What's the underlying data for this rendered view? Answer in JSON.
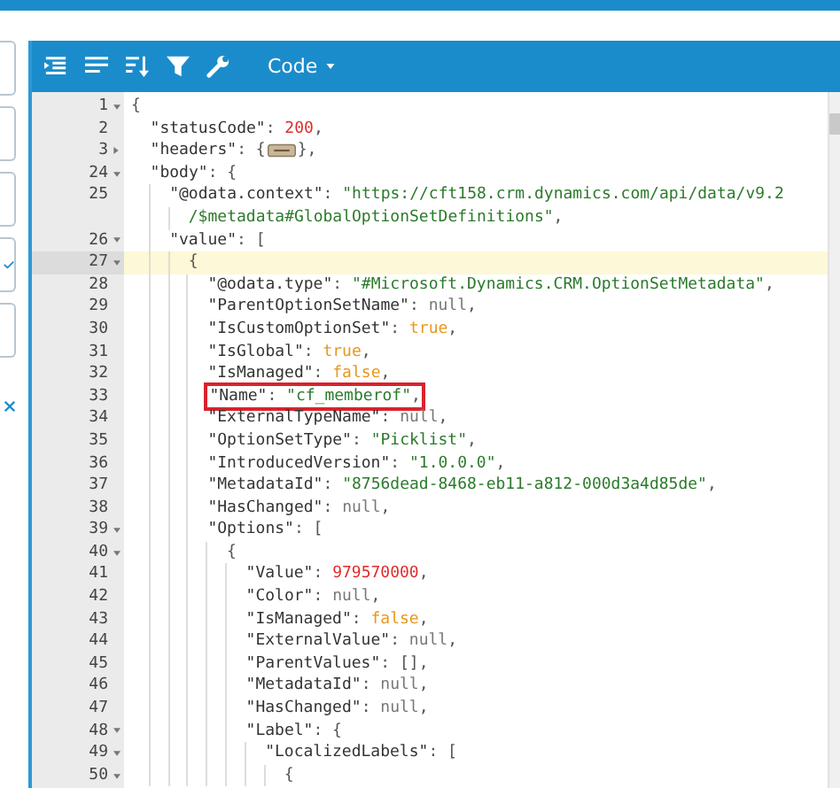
{
  "sidebar": {
    "tabs": [
      {
        "kind": "plain"
      },
      {
        "kind": "plain"
      },
      {
        "kind": "plain"
      },
      {
        "kind": "check"
      },
      {
        "kind": "plain"
      }
    ]
  },
  "toolbar": {
    "mode": "Code"
  },
  "editor": {
    "lines": [
      {
        "num": "1",
        "kind": "block",
        "expanded": true,
        "active": false,
        "boxed": false,
        "tokens": [
          {
            "kind": "punct",
            "text": "{"
          }
        ],
        "children": [
          {
            "num": "2",
            "kind": "line",
            "active": false,
            "boxed": false,
            "tokens": [
              {
                "kind": "key",
                "text": "\"statusCode\""
              },
              {
                "kind": "punct",
                "text": ": "
              },
              {
                "kind": "number",
                "text": "200"
              },
              {
                "kind": "punct",
                "text": ","
              }
            ]
          },
          {
            "num": "3",
            "kind": "block",
            "expanded": false,
            "active": false,
            "boxed": false,
            "tokens": [
              {
                "kind": "key",
                "text": "\"headers\""
              },
              {
                "kind": "punct",
                "text": ": {"
              },
              {
                "kind": "placeholder"
              },
              {
                "kind": "punct",
                "text": "},"
              }
            ]
          },
          {
            "num": "24",
            "kind": "block",
            "expanded": true,
            "active": false,
            "boxed": false,
            "tokens": [
              {
                "kind": "key",
                "text": "\"body\""
              },
              {
                "kind": "punct",
                "text": ": {"
              }
            ],
            "children": [
              {
                "num": "25",
                "kind": "line",
                "active": false,
                "boxed": false,
                "tokens": [
                  {
                    "kind": "key",
                    "text": "\"@odata.context\""
                  },
                  {
                    "kind": "punct",
                    "text": ": "
                  },
                  {
                    "kind": "string",
                    "text": "\"https://cft158.crm.dynamics.com/api/data/v9.2"
                  }
                ],
                "wrap": [
                  {
                    "kind": "string",
                    "text": "/$metadata#GlobalOptionSetDefinitions\""
                  },
                  {
                    "kind": "punct",
                    "text": ","
                  }
                ]
              },
              {
                "num": "26",
                "kind": "block",
                "expanded": true,
                "active": false,
                "boxed": false,
                "tokens": [
                  {
                    "kind": "key",
                    "text": "\"value\""
                  },
                  {
                    "kind": "punct",
                    "text": ": ["
                  }
                ],
                "children": [
                  {
                    "num": "27",
                    "kind": "block",
                    "expanded": true,
                    "active": true,
                    "boxed": false,
                    "tokens": [
                      {
                        "kind": "punct",
                        "text": "{"
                      }
                    ],
                    "children": [
                      {
                        "num": "28",
                        "kind": "line",
                        "active": false,
                        "boxed": false,
                        "tokens": [
                          {
                            "kind": "key",
                            "text": "\"@odata.type\""
                          },
                          {
                            "kind": "punct",
                            "text": ": "
                          },
                          {
                            "kind": "string",
                            "text": "\"#Microsoft.Dynamics.CRM.OptionSetMetadata\""
                          },
                          {
                            "kind": "punct",
                            "text": ","
                          }
                        ]
                      },
                      {
                        "num": "29",
                        "kind": "line",
                        "active": false,
                        "boxed": false,
                        "tokens": [
                          {
                            "kind": "key",
                            "text": "\"ParentOptionSetName\""
                          },
                          {
                            "kind": "punct",
                            "text": ": "
                          },
                          {
                            "kind": "null",
                            "text": "null"
                          },
                          {
                            "kind": "punct",
                            "text": ","
                          }
                        ]
                      },
                      {
                        "num": "30",
                        "kind": "line",
                        "active": false,
                        "boxed": false,
                        "tokens": [
                          {
                            "kind": "key",
                            "text": "\"IsCustomOptionSet\""
                          },
                          {
                            "kind": "punct",
                            "text": ": "
                          },
                          {
                            "kind": "bool",
                            "text": "true"
                          },
                          {
                            "kind": "punct",
                            "text": ","
                          }
                        ]
                      },
                      {
                        "num": "31",
                        "kind": "line",
                        "active": false,
                        "boxed": false,
                        "tokens": [
                          {
                            "kind": "key",
                            "text": "\"IsGlobal\""
                          },
                          {
                            "kind": "punct",
                            "text": ": "
                          },
                          {
                            "kind": "bool",
                            "text": "true"
                          },
                          {
                            "kind": "punct",
                            "text": ","
                          }
                        ]
                      },
                      {
                        "num": "32",
                        "kind": "line",
                        "active": false,
                        "boxed": false,
                        "tokens": [
                          {
                            "kind": "key",
                            "text": "\"IsManaged\""
                          },
                          {
                            "kind": "punct",
                            "text": ": "
                          },
                          {
                            "kind": "bool",
                            "text": "false"
                          },
                          {
                            "kind": "punct",
                            "text": ","
                          }
                        ]
                      },
                      {
                        "num": "33",
                        "kind": "line",
                        "active": false,
                        "boxed": true,
                        "tokens": [
                          {
                            "kind": "key",
                            "text": "\"Name\""
                          },
                          {
                            "kind": "punct",
                            "text": ": "
                          },
                          {
                            "kind": "string",
                            "text": "\"cf_memberof\""
                          },
                          {
                            "kind": "punct",
                            "text": ","
                          }
                        ]
                      },
                      {
                        "num": "34",
                        "kind": "line",
                        "active": false,
                        "boxed": false,
                        "tokens": [
                          {
                            "kind": "key",
                            "text": "\"ExternalTypeName\""
                          },
                          {
                            "kind": "punct",
                            "text": ": "
                          },
                          {
                            "kind": "null",
                            "text": "null"
                          },
                          {
                            "kind": "punct",
                            "text": ","
                          }
                        ]
                      },
                      {
                        "num": "35",
                        "kind": "line",
                        "active": false,
                        "boxed": false,
                        "tokens": [
                          {
                            "kind": "key",
                            "text": "\"OptionSetType\""
                          },
                          {
                            "kind": "punct",
                            "text": ": "
                          },
                          {
                            "kind": "string",
                            "text": "\"Picklist\""
                          },
                          {
                            "kind": "punct",
                            "text": ","
                          }
                        ]
                      },
                      {
                        "num": "36",
                        "kind": "line",
                        "active": false,
                        "boxed": false,
                        "tokens": [
                          {
                            "kind": "key",
                            "text": "\"IntroducedVersion\""
                          },
                          {
                            "kind": "punct",
                            "text": ": "
                          },
                          {
                            "kind": "string",
                            "text": "\"1.0.0.0\""
                          },
                          {
                            "kind": "punct",
                            "text": ","
                          }
                        ]
                      },
                      {
                        "num": "37",
                        "kind": "line",
                        "active": false,
                        "boxed": false,
                        "tokens": [
                          {
                            "kind": "key",
                            "text": "\"MetadataId\""
                          },
                          {
                            "kind": "punct",
                            "text": ": "
                          },
                          {
                            "kind": "string",
                            "text": "\"8756dead-8468-eb11-a812-000d3a4d85de\""
                          },
                          {
                            "kind": "punct",
                            "text": ","
                          }
                        ]
                      },
                      {
                        "num": "38",
                        "kind": "line",
                        "active": false,
                        "boxed": false,
                        "tokens": [
                          {
                            "kind": "key",
                            "text": "\"HasChanged\""
                          },
                          {
                            "kind": "punct",
                            "text": ": "
                          },
                          {
                            "kind": "null",
                            "text": "null"
                          },
                          {
                            "kind": "punct",
                            "text": ","
                          }
                        ]
                      },
                      {
                        "num": "39",
                        "kind": "block",
                        "expanded": true,
                        "active": false,
                        "boxed": false,
                        "tokens": [
                          {
                            "kind": "key",
                            "text": "\"Options\""
                          },
                          {
                            "kind": "punct",
                            "text": ": ["
                          }
                        ],
                        "children": [
                          {
                            "num": "40",
                            "kind": "block",
                            "expanded": true,
                            "active": false,
                            "boxed": false,
                            "tokens": [
                              {
                                "kind": "punct",
                                "text": "{"
                              }
                            ],
                            "children": [
                              {
                                "num": "41",
                                "kind": "line",
                                "active": false,
                                "boxed": false,
                                "tokens": [
                                  {
                                    "kind": "key",
                                    "text": "\"Value\""
                                  },
                                  {
                                    "kind": "punct",
                                    "text": ": "
                                  },
                                  {
                                    "kind": "number",
                                    "text": "979570000"
                                  },
                                  {
                                    "kind": "punct",
                                    "text": ","
                                  }
                                ]
                              },
                              {
                                "num": "42",
                                "kind": "line",
                                "active": false,
                                "boxed": false,
                                "tokens": [
                                  {
                                    "kind": "key",
                                    "text": "\"Color\""
                                  },
                                  {
                                    "kind": "punct",
                                    "text": ": "
                                  },
                                  {
                                    "kind": "null",
                                    "text": "null"
                                  },
                                  {
                                    "kind": "punct",
                                    "text": ","
                                  }
                                ]
                              },
                              {
                                "num": "43",
                                "kind": "line",
                                "active": false,
                                "boxed": false,
                                "tokens": [
                                  {
                                    "kind": "key",
                                    "text": "\"IsManaged\""
                                  },
                                  {
                                    "kind": "punct",
                                    "text": ": "
                                  },
                                  {
                                    "kind": "bool",
                                    "text": "false"
                                  },
                                  {
                                    "kind": "punct",
                                    "text": ","
                                  }
                                ]
                              },
                              {
                                "num": "44",
                                "kind": "line",
                                "active": false,
                                "boxed": false,
                                "tokens": [
                                  {
                                    "kind": "key",
                                    "text": "\"ExternalValue\""
                                  },
                                  {
                                    "kind": "punct",
                                    "text": ": "
                                  },
                                  {
                                    "kind": "null",
                                    "text": "null"
                                  },
                                  {
                                    "kind": "punct",
                                    "text": ","
                                  }
                                ]
                              },
                              {
                                "num": "45",
                                "kind": "line",
                                "active": false,
                                "boxed": false,
                                "tokens": [
                                  {
                                    "kind": "key",
                                    "text": "\"ParentValues\""
                                  },
                                  {
                                    "kind": "punct",
                                    "text": ": [],"
                                  }
                                ]
                              },
                              {
                                "num": "46",
                                "kind": "line",
                                "active": false,
                                "boxed": false,
                                "tokens": [
                                  {
                                    "kind": "key",
                                    "text": "\"MetadataId\""
                                  },
                                  {
                                    "kind": "punct",
                                    "text": ": "
                                  },
                                  {
                                    "kind": "null",
                                    "text": "null"
                                  },
                                  {
                                    "kind": "punct",
                                    "text": ","
                                  }
                                ]
                              },
                              {
                                "num": "47",
                                "kind": "line",
                                "active": false,
                                "boxed": false,
                                "tokens": [
                                  {
                                    "kind": "key",
                                    "text": "\"HasChanged\""
                                  },
                                  {
                                    "kind": "punct",
                                    "text": ": "
                                  },
                                  {
                                    "kind": "null",
                                    "text": "null"
                                  },
                                  {
                                    "kind": "punct",
                                    "text": ","
                                  }
                                ]
                              },
                              {
                                "num": "48",
                                "kind": "block",
                                "expanded": true,
                                "active": false,
                                "boxed": false,
                                "tokens": [
                                  {
                                    "kind": "key",
                                    "text": "\"Label\""
                                  },
                                  {
                                    "kind": "punct",
                                    "text": ": {"
                                  }
                                ],
                                "children": [
                                  {
                                    "num": "49",
                                    "kind": "block",
                                    "expanded": true,
                                    "active": false,
                                    "boxed": false,
                                    "tokens": [
                                      {
                                        "kind": "key",
                                        "text": "\"LocalizedLabels\""
                                      },
                                      {
                                        "kind": "punct",
                                        "text": ": ["
                                      }
                                    ],
                                    "children": [
                                      {
                                        "num": "50",
                                        "kind": "block",
                                        "expanded": true,
                                        "active": false,
                                        "boxed": false,
                                        "tokens": [
                                          {
                                            "kind": "punct",
                                            "text": "{"
                                          }
                                        ]
                                      }
                                    ]
                                  }
                                ]
                              }
                            ]
                          }
                        ]
                      }
                    ]
                  }
                ]
              }
            ]
          }
        ]
      }
    ]
  }
}
